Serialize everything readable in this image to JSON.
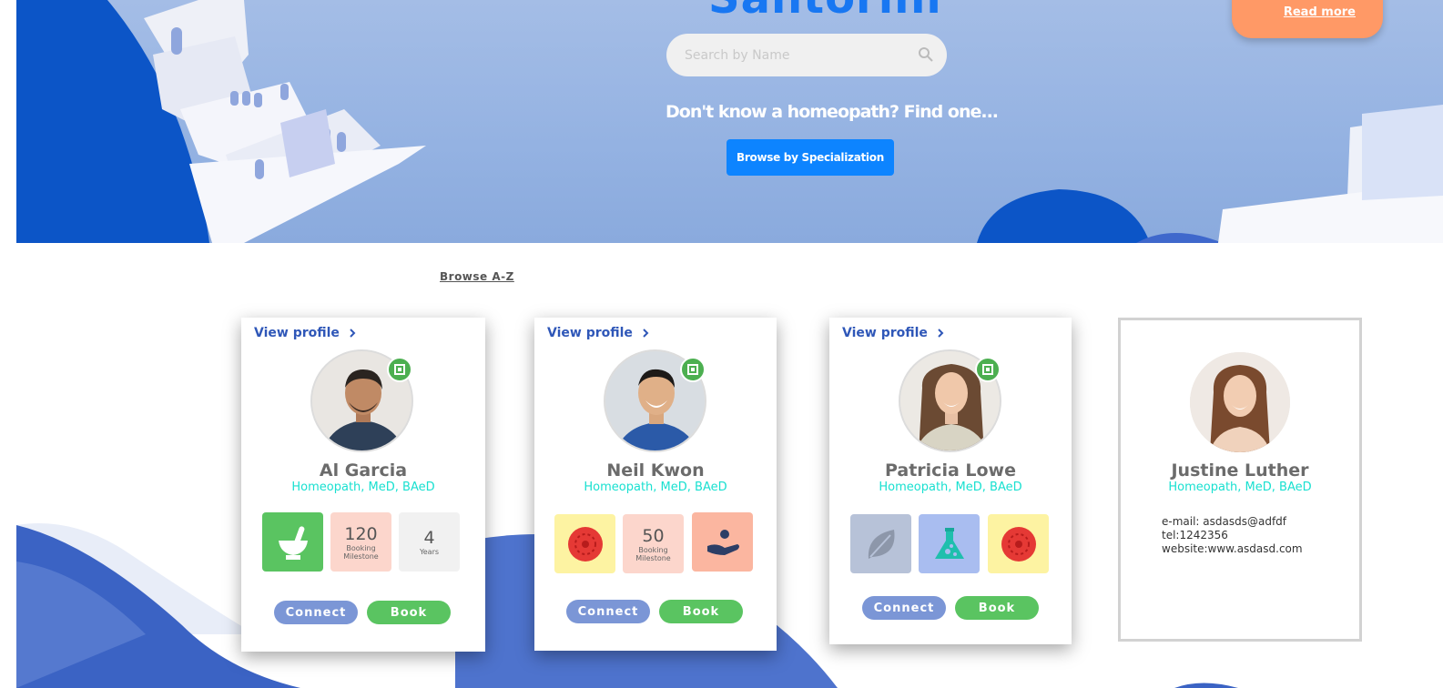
{
  "hero": {
    "title": "Santorini",
    "read_more": "Read more",
    "search_placeholder": "Search by Name",
    "tagline": "Don't know a homeopath? Find one...",
    "browse_specialization": "Browse by Specialization"
  },
  "browse_az": "Browse A-Z",
  "cards": [
    {
      "view_profile": "View profile",
      "name": "Al Garcia",
      "credentials": "Homeopath, MeD, BAeD",
      "tiles": [
        {
          "icon": "mortar-pestle-icon",
          "bg": "#5ac461"
        },
        {
          "big": "120",
          "small": "Booking Milestone",
          "bg": "#fcd6cc"
        },
        {
          "big": "4",
          "small": "Years",
          "bg": "#f1f1f1"
        }
      ],
      "connect": "Connect",
      "book": "Book"
    },
    {
      "view_profile": "View profile",
      "name": "Neil Kwon",
      "credentials": "Homeopath, MeD, BAeD",
      "tiles": [
        {
          "icon": "tomato-icon",
          "bg": "#fdf3a2"
        },
        {
          "big": "50",
          "small": "Booking Milestone",
          "bg": "#fcd6cc"
        },
        {
          "icon": "hand-care-icon",
          "bg": "#fbb6a0"
        }
      ],
      "connect": "Connect",
      "book": "Book"
    },
    {
      "view_profile": "View profile",
      "name": "Patricia Lowe",
      "credentials": "Homeopath, MeD, BAeD",
      "tiles": [
        {
          "icon": "leaf-icon",
          "bg": "#b7c2d8"
        },
        {
          "icon": "flask-icon",
          "bg": "#a9bdf0"
        },
        {
          "icon": "tomato-icon",
          "bg": "#fdf3a2"
        }
      ],
      "connect": "Connect",
      "book": "Book"
    },
    {
      "name": "Justine Luther",
      "credentials": "Homeopath, MeD, BAeD",
      "email": "e-mail: asdasds@adfdf",
      "tel": "tel:1242356",
      "website": "website:www.asdasd.com"
    }
  ],
  "colors": {
    "accent_blue": "#1877f2",
    "cyan_credentials": "#19e0d0",
    "connect_button": "#7b96d6",
    "book_button": "#5ac461",
    "read_more_orange": "#ff9966",
    "verified_badge": "#4caf50"
  }
}
